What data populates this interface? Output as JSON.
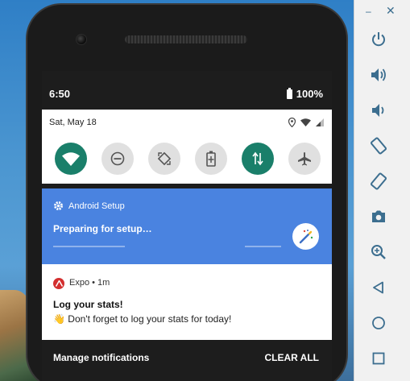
{
  "status_bar": {
    "time": "6:50",
    "battery": "100%"
  },
  "quick_settings": {
    "date": "Sat, May 18"
  },
  "setup_notification": {
    "app_name": "Android Setup",
    "text": "Preparing for setup…"
  },
  "expo_notification": {
    "app_name": "Expo",
    "age": " • 1m",
    "title": "Log your stats!",
    "body": "👋 Don't forget to log your stats for today!"
  },
  "footer": {
    "manage": "Manage notifications",
    "clear_all": "CLEAR ALL"
  },
  "toolbar": {
    "minimize": "–",
    "close": "✕"
  },
  "colors": {
    "setup_bg": "#4a83e0",
    "active_tile": "#1a7f6a",
    "toolbar_icon": "#3c6e8f"
  }
}
